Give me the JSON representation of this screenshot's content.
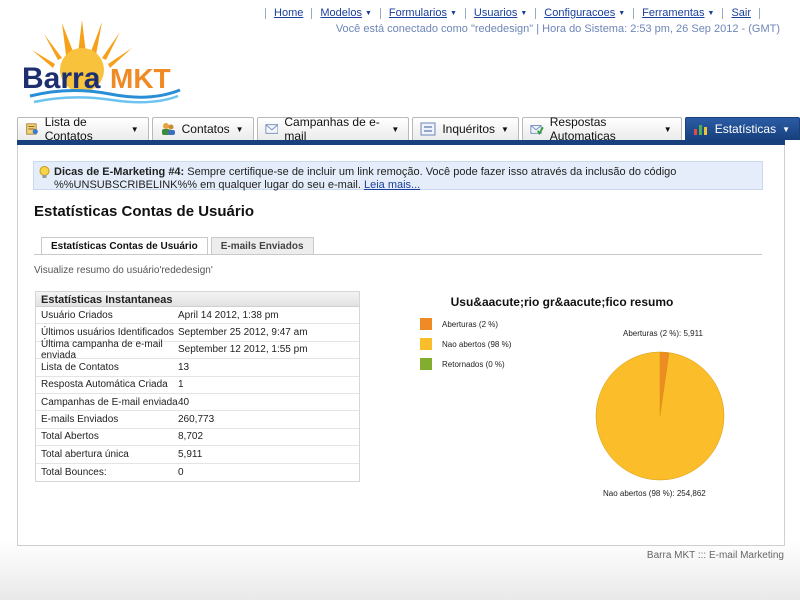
{
  "nav": {
    "items": [
      {
        "label": "Home",
        "dropdown": false
      },
      {
        "label": "Modelos",
        "dropdown": true
      },
      {
        "label": "Formularios",
        "dropdown": true
      },
      {
        "label": "Usuarios",
        "dropdown": true
      },
      {
        "label": "Configuracoes",
        "dropdown": true
      },
      {
        "label": "Ferramentas",
        "dropdown": true
      },
      {
        "label": "Sair",
        "dropdown": false
      }
    ],
    "status": "Você está conectado como \"rededesign\" | Hora do Sistema: 2:53 pm, 26 Sep 2012 - (GMT)"
  },
  "logo": {
    "text_barra": "Barra",
    "text_mkt": "MKT"
  },
  "tabs": [
    {
      "label": "Lista de Contatos",
      "icon": "contact-list-icon",
      "active": false
    },
    {
      "label": "Contatos",
      "icon": "contacts-icon",
      "active": false
    },
    {
      "label": "Campanhas de e-mail",
      "icon": "envelope-icon",
      "active": false
    },
    {
      "label": "Inquéritos",
      "icon": "survey-icon",
      "active": false
    },
    {
      "label": "Respostas Automaticas",
      "icon": "autoresponder-icon",
      "active": false
    },
    {
      "label": "Estatísticas",
      "icon": "bar-chart-icon",
      "active": true
    }
  ],
  "tip": {
    "title": "Dicas de E-Marketing #4:",
    "text": " Sempre certifique-se de incluir um link remoção. Você pode fazer isso através da inclusão do código %%UNSUBSCRIBELINK%% em qualquer lugar do seu e-mail. ",
    "link": "Leia mais..."
  },
  "page": {
    "title": "Estatísticas Contas de Usuário",
    "subtabs": [
      "Estatísticas Contas de Usuário",
      "E-mails Enviados"
    ],
    "summary": "Visualize resumo do usuário'rededesign'"
  },
  "stats": {
    "header": "Estatísticas Instantaneas",
    "rows": [
      {
        "label": "Usuário Criados",
        "value": "April 14 2012, 1:38 pm"
      },
      {
        "label": "Últimos usuários Identificados",
        "value": "September 25 2012, 9:47 am"
      },
      {
        "label": "Última campanha de e-mail enviada",
        "value": "September 12 2012, 1:55 pm"
      },
      {
        "label": "Lista de Contatos",
        "value": "13"
      },
      {
        "label": "Resposta Automática Criada",
        "value": "1"
      },
      {
        "label": "Campanhas de E-mail enviada",
        "value": "40"
      },
      {
        "label": "E-mails Enviados",
        "value": "260,773"
      },
      {
        "label": "Total Abertos",
        "value": "8,702"
      },
      {
        "label": "Total abertura única",
        "value": "5,911"
      },
      {
        "label": "Total Bounces:",
        "value": "0"
      }
    ]
  },
  "chart_data": {
    "type": "pie",
    "title": "Usu&aacute;rio gr&aacute;fico resumo",
    "legend_position": "top-left",
    "legend": [
      "Aberturas (2 %)",
      "Nao abertos (98 %)",
      "Retornados (0 %)"
    ],
    "slices": [
      {
        "name": "Aberturas",
        "value": 5911,
        "color": "#f08a24",
        "label": "Aberturas (2 %): 5,911"
      },
      {
        "name": "Nao abertos",
        "value": 254862,
        "color": "#fbbd2a",
        "label": "Nao abertos (98 %): 254,862"
      },
      {
        "name": "Retornados",
        "value": 0,
        "color": "#82ad2e",
        "label": ""
      }
    ]
  },
  "footer": "Barra MKT ::: E-mail Marketing",
  "colors": {
    "primary": "#17407d",
    "link": "#1a3f9a",
    "tip_bg": "#e4edf9"
  }
}
